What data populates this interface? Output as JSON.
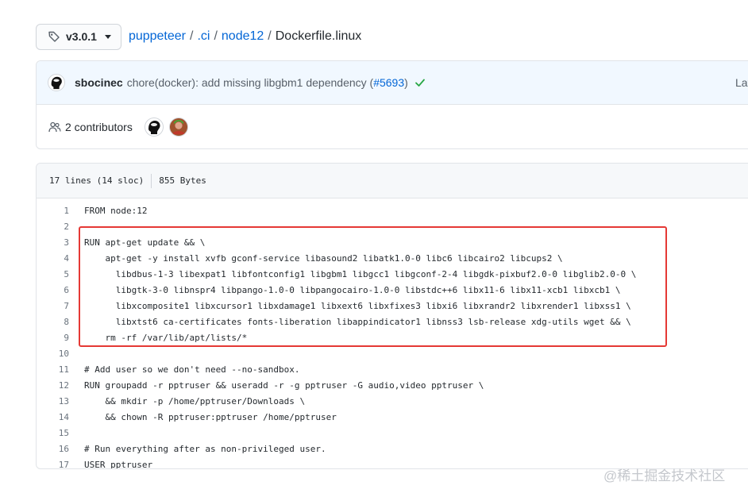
{
  "header": {
    "tag_label": "v3.0.1",
    "breadcrumb": [
      "puppeteer",
      ".ci",
      "node12"
    ],
    "separator": "/",
    "file_name": "Dockerfile.linux"
  },
  "commit": {
    "author": "sbocinec",
    "message": "chore(docker): add missing libgbm1 dependency (",
    "pr_link": "#5693",
    "message_end": ")",
    "latest_label": "Lat"
  },
  "contributors": {
    "label": "2 contributors"
  },
  "file_info": {
    "lines": "17 lines (14 sloc)",
    "size": "855 Bytes"
  },
  "code_lines": [
    {
      "n": "1",
      "t": "FROM node:12"
    },
    {
      "n": "2",
      "t": ""
    },
    {
      "n": "3",
      "t": "RUN apt-get update && \\"
    },
    {
      "n": "4",
      "t": "    apt-get -y install xvfb gconf-service libasound2 libatk1.0-0 libc6 libcairo2 libcups2 \\"
    },
    {
      "n": "5",
      "t": "      libdbus-1-3 libexpat1 libfontconfig1 libgbm1 libgcc1 libgconf-2-4 libgdk-pixbuf2.0-0 libglib2.0-0 \\"
    },
    {
      "n": "6",
      "t": "      libgtk-3-0 libnspr4 libpango-1.0-0 libpangocairo-1.0-0 libstdc++6 libx11-6 libx11-xcb1 libxcb1 \\"
    },
    {
      "n": "7",
      "t": "      libxcomposite1 libxcursor1 libxdamage1 libxext6 libxfixes3 libxi6 libxrandr2 libxrender1 libxss1 \\"
    },
    {
      "n": "8",
      "t": "      libxtst6 ca-certificates fonts-liberation libappindicator1 libnss3 lsb-release xdg-utils wget && \\"
    },
    {
      "n": "9",
      "t": "    rm -rf /var/lib/apt/lists/*"
    },
    {
      "n": "10",
      "t": ""
    },
    {
      "n": "11",
      "t": "# Add user so we don't need --no-sandbox."
    },
    {
      "n": "12",
      "t": "RUN groupadd -r pptruser && useradd -r -g pptruser -G audio,video pptruser \\"
    },
    {
      "n": "13",
      "t": "    && mkdir -p /home/pptruser/Downloads \\"
    },
    {
      "n": "14",
      "t": "    && chown -R pptruser:pptruser /home/pptruser"
    },
    {
      "n": "15",
      "t": ""
    },
    {
      "n": "16",
      "t": "# Run everything after as non-privileged user."
    },
    {
      "n": "17",
      "t": "USER pptruser"
    }
  ],
  "watermark": "@稀土掘金技术社区",
  "colors": {
    "link": "#0366d6",
    "highlight_border": "#e53935",
    "success": "#28a745"
  },
  "icons": [
    "tag-icon",
    "people-icon",
    "check-icon"
  ]
}
